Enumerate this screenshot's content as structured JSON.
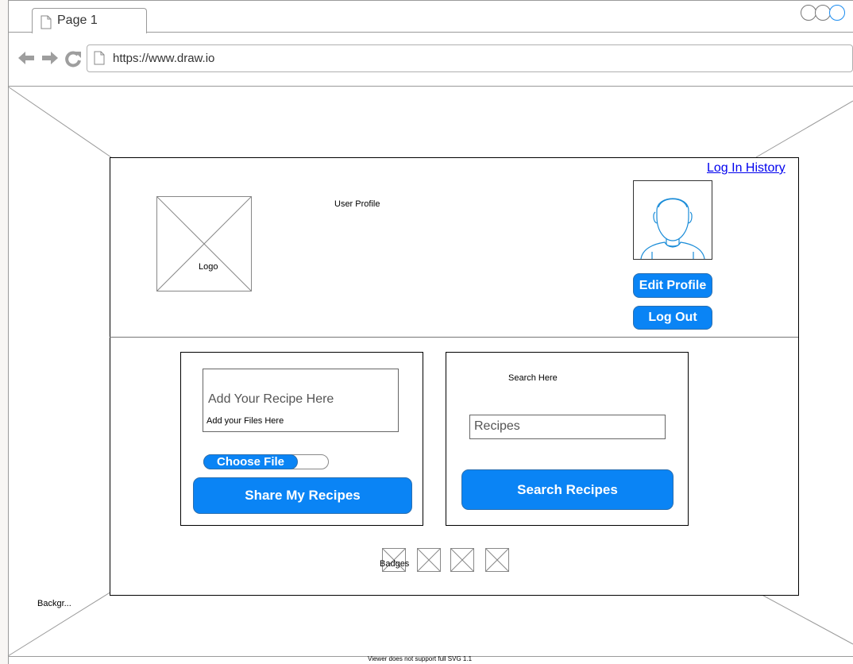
{
  "browser": {
    "tab_title": "Page 1",
    "url": "https://www.draw.io"
  },
  "header": {
    "login_history_link": "Log In History",
    "logo_label": "Logo",
    "page_title": "User Profile",
    "edit_profile_label": "Edit Profile",
    "logout_label": "Log Out"
  },
  "recipe_panel": {
    "recipe_placeholder": "Add Your Recipe Here",
    "files_label": "Add  your Files Here",
    "choose_file_label": "Choose File",
    "share_label": "Share My Recipes"
  },
  "search_panel": {
    "heading": "Search Here",
    "search_placeholder": "Recipes",
    "search_button_label": "Search Recipes"
  },
  "badges": {
    "label": "Badges",
    "count": 4
  },
  "background_label": "Backgr...",
  "footer_note": "Viewer does not support full SVG 1.1",
  "colors": {
    "accent": "#0a84f5",
    "link": "#0000ee",
    "wire": "#9a9a9a"
  }
}
